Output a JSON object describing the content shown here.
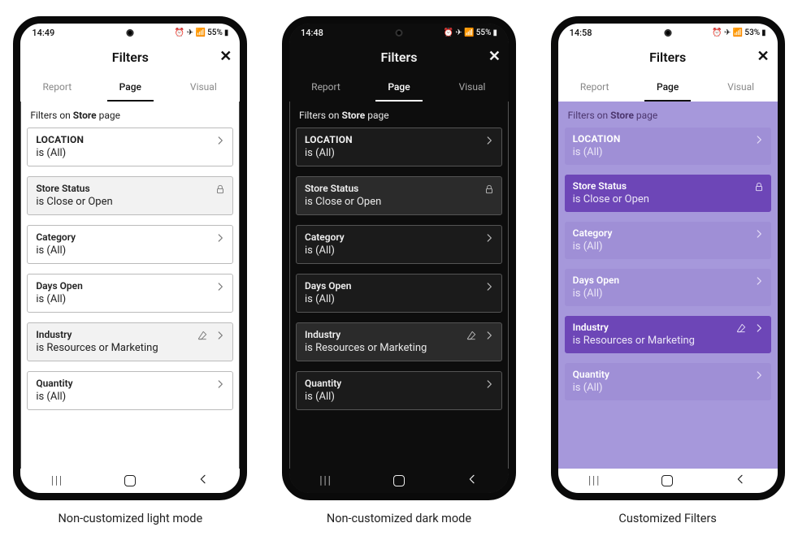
{
  "captions": {
    "light": "Non-customized light mode",
    "dark": "Non-customized dark mode",
    "custom": "Customized Filters"
  },
  "panes": [
    {
      "id": "light",
      "status_time": "14:49",
      "status_right": "55%",
      "header_title": "Filters",
      "tabs": {
        "report": "Report",
        "page": "Page",
        "visual": "Visual",
        "active": "page"
      },
      "subhead_prefix": "Filters on ",
      "subhead_bold": "Store",
      "subhead_suffix": " page",
      "cards": [
        {
          "title": "LOCATION",
          "value": "is (All)",
          "strong": true,
          "chevron": true
        },
        {
          "title": "Store Status",
          "value": "is Close or Open",
          "lock": true,
          "highlight": true
        },
        {
          "title": "Category",
          "value": "is (All)",
          "chevron": true
        },
        {
          "title": "Days Open",
          "value": "is (All)",
          "chevron": true
        },
        {
          "title": "Industry",
          "value": "is Resources or Marketing",
          "erase": true,
          "chevron": true,
          "highlight": true
        },
        {
          "title": "Quantity",
          "value": "is (All)",
          "chevron": true
        }
      ]
    },
    {
      "id": "dark",
      "status_time": "14:48",
      "status_right": "55%",
      "header_title": "Filters",
      "tabs": {
        "report": "Report",
        "page": "Page",
        "visual": "Visual",
        "active": "page"
      },
      "subhead_prefix": "Filters on ",
      "subhead_bold": "Store",
      "subhead_suffix": " page",
      "cards": [
        {
          "title": "LOCATION",
          "value": "is (All)",
          "strong": true,
          "chevron": true
        },
        {
          "title": "Store Status",
          "value": "is Close or Open",
          "lock": true,
          "highlight": true
        },
        {
          "title": "Category",
          "value": "is (All)",
          "chevron": true
        },
        {
          "title": "Days Open",
          "value": "is (All)",
          "chevron": true
        },
        {
          "title": "Industry",
          "value": "is Resources or Marketing",
          "erase": true,
          "chevron": true,
          "highlight": true
        },
        {
          "title": "Quantity",
          "value": "is (All)",
          "chevron": true
        }
      ]
    },
    {
      "id": "custom",
      "status_time": "14:58",
      "status_right": "53%",
      "header_title": "Filters",
      "tabs": {
        "report": "Report",
        "page": "Page",
        "visual": "Visual",
        "active": "page"
      },
      "subhead_prefix": "Filters on ",
      "subhead_bold": "Store",
      "subhead_suffix": " page",
      "cards": [
        {
          "title": "LOCATION",
          "value": "is (All)",
          "strong": true,
          "chevron": true
        },
        {
          "title": "Store Status",
          "value": "is Close or Open",
          "lock": true,
          "highlight": true
        },
        {
          "title": "Category",
          "value": "is (All)",
          "chevron": true
        },
        {
          "title": "Days Open",
          "value": "is (All)",
          "chevron": true
        },
        {
          "title": "Industry",
          "value": "is Resources or Marketing",
          "erase": true,
          "chevron": true,
          "highlight": true
        },
        {
          "title": "Quantity",
          "value": "is (All)",
          "chevron": true
        }
      ]
    }
  ]
}
